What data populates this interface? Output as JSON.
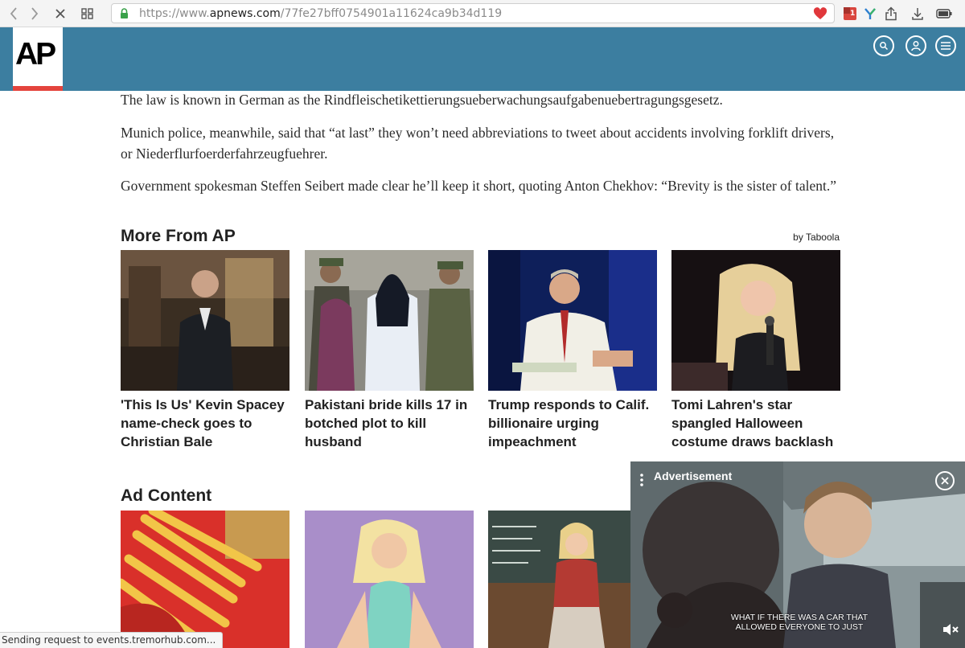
{
  "browser": {
    "url_prefix": "https://www.",
    "url_domain": "apnews.com",
    "url_path": "/77fe27bff0754901a11624ca9b34d119",
    "extension_badge": "1"
  },
  "header": {
    "logo_text": "AP",
    "brand_color": "#3c7ea0",
    "accent_color": "#e4443d"
  },
  "article": {
    "paragraphs": [
      "The law is known in German as the Rindfleischetikettierungsueberwachungsaufgabenuebertragungsgesetz.",
      "Munich police, meanwhile, said that “at last” they won’t need abbreviations to tweet about accidents involving forklift drivers, or Niederflurfoerderfahrzeugfuehrer.",
      "Government spokesman Steffen Seibert made clear he’ll keep it short, quoting Anton Chekhov: “Brevity is the sister of talent.”"
    ]
  },
  "more_from_ap": {
    "title": "More From AP",
    "sponsor": "by Taboola",
    "cards": [
      {
        "title": "'This Is Us' Kevin Spacey name-check goes to Christian Bale"
      },
      {
        "title": "Pakistani bride kills 17 in botched plot to kill husband"
      },
      {
        "title": "Trump responds to Calif. billionaire urging impeachment"
      },
      {
        "title": "Tomi Lahren's star spangled Halloween costume draws backlash"
      }
    ]
  },
  "ad_content": {
    "title": "Ad Content"
  },
  "video_ad": {
    "label": "Advertisement",
    "caption": "WHAT IF THERE WAS A CAR THAT ALLOWED EVERYONE TO JUST"
  },
  "status": {
    "text": "Sending request to events.tremorhub.com..."
  }
}
